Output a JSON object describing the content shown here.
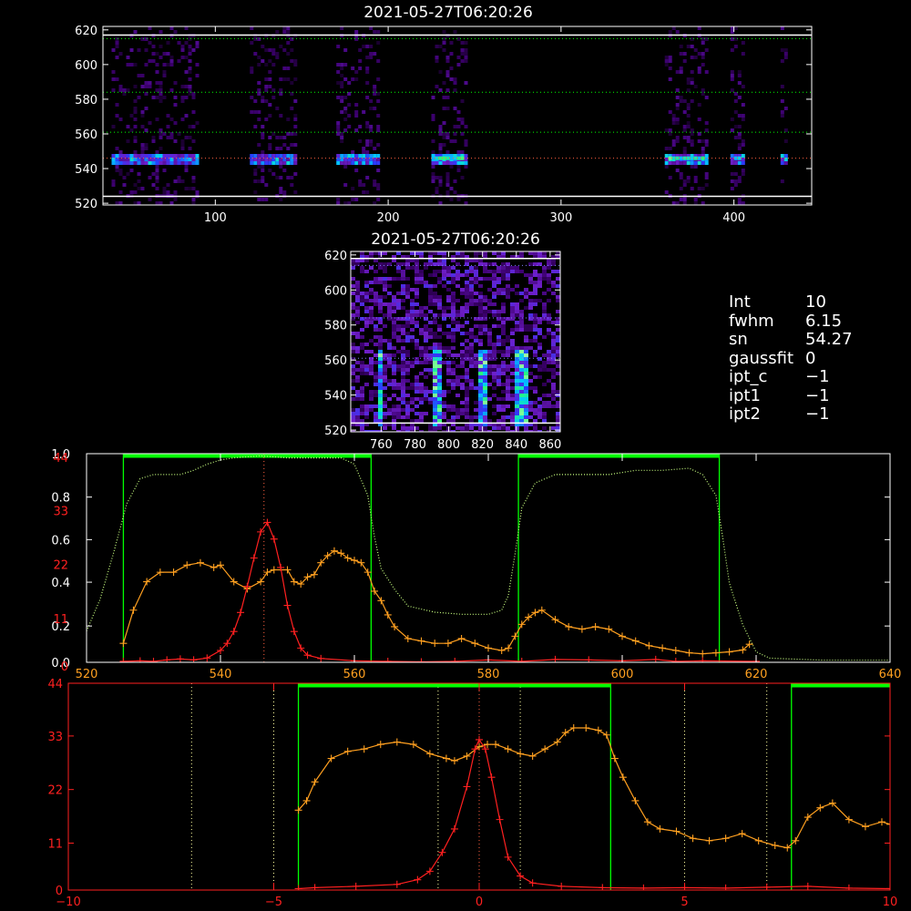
{
  "colors": {
    "background": "#000000",
    "axes": "#ffffff",
    "red_curve": "#ff2020",
    "orange_curve": "#ffa020",
    "green_window": "#00ff00",
    "dotted_curve": "#c8ff80",
    "ref_line": "#ff6040",
    "guide": "#ffffa0"
  },
  "info": [
    {
      "key": "Int",
      "value": "10"
    },
    {
      "key": "fwhm",
      "value": "6.15"
    },
    {
      "key": "sn",
      "value": "54.27"
    },
    {
      "key": "gaussfit",
      "value": "0"
    },
    {
      "key": "ipt_c",
      "value": "−1"
    },
    {
      "key": "ipt1",
      "value": "−1"
    },
    {
      "key": "ipt2",
      "value": "−1"
    }
  ],
  "chart_data": [
    {
      "id": "top_image",
      "type": "heatmap",
      "title": "2021-05-27T06:20:26",
      "xlim": [
        35,
        445
      ],
      "ylim": [
        519,
        622
      ],
      "xticks": [
        100,
        200,
        300,
        400
      ],
      "yticks": [
        520,
        540,
        560,
        580,
        600,
        620
      ],
      "data_columns": [
        [
          40,
          90
        ],
        [
          120,
          147
        ],
        [
          170,
          195
        ],
        [
          225,
          245
        ],
        [
          360,
          385
        ],
        [
          398,
          405
        ],
        [
          427,
          430
        ]
      ],
      "emission_row": 546,
      "white_lines": [
        524,
        617
      ],
      "dotted_green_lines": [
        561,
        584,
        615
      ],
      "dotted_red_line": 546
    },
    {
      "id": "zoom_image",
      "type": "heatmap",
      "title": "2021-05-27T06:20:26",
      "xlim": [
        742,
        866
      ],
      "ylim": [
        519,
        622
      ],
      "xticks": [
        760,
        780,
        800,
        820,
        840,
        860
      ],
      "yticks": [
        520,
        540,
        560,
        580,
        600,
        620
      ],
      "bright_columns": [
        758,
        792,
        818,
        840,
        842
      ],
      "white_lines": [
        524,
        618
      ],
      "dotted_lines": [
        561,
        584,
        614
      ]
    },
    {
      "id": "profile_wavelength",
      "type": "line",
      "xlim": [
        520,
        640
      ],
      "xticks": [
        520,
        540,
        560,
        580,
        600,
        620,
        640
      ],
      "left_ticks": [
        {
          "label": "0.0",
          "frac": 0.0
        },
        {
          "label": "0.2",
          "frac": 0.174
        },
        {
          "label": "0.4",
          "frac": 0.384
        },
        {
          "label": "0.6",
          "frac": 0.588
        },
        {
          "label": "0.8",
          "frac": 0.792
        },
        {
          "label": "1.0",
          "frac": 1.0
        }
      ],
      "red_ticks": [
        {
          "label": "0",
          "frac": 0.0
        },
        {
          "label": "11",
          "frac": 0.227
        },
        {
          "label": "22",
          "frac": 0.486
        },
        {
          "label": "33",
          "frac": 0.745
        },
        {
          "label": "44",
          "frac": 1.0
        }
      ],
      "ymax": 44,
      "green_windows": [
        [
          525.5,
          562.5
        ],
        [
          584.5,
          614.5
        ]
      ],
      "ref_line_x": 546.5,
      "series": [
        {
          "color": "orange",
          "points": [
            [
              525.5,
              4
            ],
            [
              527,
              11
            ],
            [
              529,
              17
            ],
            [
              531,
              19
            ],
            [
              533,
              19
            ],
            [
              535,
              20.5
            ],
            [
              537,
              21
            ],
            [
              539,
              20
            ],
            [
              540,
              20.5
            ],
            [
              542,
              17
            ],
            [
              544,
              15.5
            ],
            [
              546,
              17
            ],
            [
              547,
              19
            ],
            [
              548,
              19.5
            ],
            [
              550,
              19.5
            ],
            [
              551,
              17
            ],
            [
              552,
              16.5
            ],
            [
              553,
              18
            ],
            [
              554,
              18.5
            ],
            [
              555,
              21
            ],
            [
              556,
              22.5
            ],
            [
              557,
              23.5
            ],
            [
              558,
              23
            ],
            [
              559,
              22
            ],
            [
              560,
              21.5
            ],
            [
              561,
              21
            ],
            [
              562,
              19
            ],
            [
              563,
              15
            ],
            [
              564,
              13
            ],
            [
              565,
              10
            ],
            [
              566,
              7.5
            ],
            [
              568,
              5
            ],
            [
              570,
              4.5
            ],
            [
              572,
              4
            ],
            [
              574,
              4
            ],
            [
              576,
              5
            ],
            [
              578,
              4
            ],
            [
              580,
              3
            ],
            [
              582,
              2.5
            ],
            [
              583,
              3
            ],
            [
              584,
              5.5
            ],
            [
              585,
              8
            ],
            [
              586,
              9.5
            ],
            [
              587,
              10.5
            ],
            [
              588,
              11
            ],
            [
              590,
              9
            ],
            [
              592,
              7.5
            ],
            [
              594,
              7
            ],
            [
              596,
              7.5
            ],
            [
              598,
              7
            ],
            [
              600,
              5.5
            ],
            [
              602,
              4.5
            ],
            [
              604,
              3.5
            ],
            [
              606,
              3
            ],
            [
              608,
              2.5
            ],
            [
              610,
              2
            ],
            [
              612,
              1.8
            ],
            [
              614,
              2
            ],
            [
              616,
              2.2
            ],
            [
              618,
              2.6
            ],
            [
              619,
              3.8
            ]
          ]
        },
        {
          "color": "red",
          "points": [
            [
              525.5,
              0.2
            ],
            [
              528,
              0.3
            ],
            [
              530,
              0.2
            ],
            [
              532,
              0.5
            ],
            [
              534,
              0.7
            ],
            [
              536,
              0.5
            ],
            [
              538,
              0.9
            ],
            [
              540,
              2.5
            ],
            [
              541,
              4
            ],
            [
              542,
              6.5
            ],
            [
              543,
              10.5
            ],
            [
              544,
              16
            ],
            [
              545,
              22
            ],
            [
              546,
              27.5
            ],
            [
              547,
              29.5
            ],
            [
              548,
              26
            ],
            [
              549,
              20
            ],
            [
              550,
              12
            ],
            [
              551,
              6.5
            ],
            [
              552,
              3
            ],
            [
              553,
              1.5
            ],
            [
              555,
              0.8
            ],
            [
              560,
              0.3
            ],
            [
              565,
              0.2
            ],
            [
              570,
              0.1
            ],
            [
              575,
              0.2
            ],
            [
              580,
              0.5
            ],
            [
              585,
              0.2
            ],
            [
              590,
              0.6
            ],
            [
              595,
              0.5
            ],
            [
              600,
              0.3
            ],
            [
              605,
              0.6
            ],
            [
              608,
              0.2
            ],
            [
              612,
              0.3
            ],
            [
              620,
              0.2
            ]
          ]
        },
        {
          "color": "dotted",
          "points": [
            [
              520,
              0.15
            ],
            [
              522,
              0.3
            ],
            [
              524,
              0.52
            ],
            [
              526,
              0.76
            ],
            [
              528,
              0.88
            ],
            [
              530,
              0.9
            ],
            [
              532,
              0.9
            ],
            [
              534,
              0.9
            ],
            [
              536,
              0.92
            ],
            [
              538,
              0.95
            ],
            [
              540,
              0.97
            ],
            [
              542,
              0.98
            ],
            [
              546,
              0.99
            ],
            [
              550,
              0.98
            ],
            [
              554,
              0.98
            ],
            [
              558,
              0.98
            ],
            [
              560,
              0.95
            ],
            [
              562,
              0.8
            ],
            [
              563,
              0.6
            ],
            [
              564,
              0.45
            ],
            [
              566,
              0.35
            ],
            [
              568,
              0.27
            ],
            [
              572,
              0.24
            ],
            [
              576,
              0.23
            ],
            [
              580,
              0.23
            ],
            [
              582,
              0.25
            ],
            [
              583,
              0.32
            ],
            [
              584,
              0.52
            ],
            [
              585,
              0.74
            ],
            [
              587,
              0.86
            ],
            [
              590,
              0.9
            ],
            [
              594,
              0.9
            ],
            [
              598,
              0.9
            ],
            [
              602,
              0.92
            ],
            [
              606,
              0.92
            ],
            [
              610,
              0.93
            ],
            [
              612,
              0.9
            ],
            [
              614,
              0.8
            ],
            [
              615,
              0.6
            ],
            [
              616,
              0.38
            ],
            [
              618,
              0.18
            ],
            [
              620,
              0.05
            ],
            [
              622,
              0.02
            ],
            [
              630,
              0.01
            ],
            [
              640,
              0.01
            ]
          ]
        }
      ]
    },
    {
      "id": "profile_velocity",
      "type": "line",
      "xlim": [
        -10,
        10
      ],
      "xticks": [
        -10,
        -5,
        0,
        5,
        10
      ],
      "y_ticks": [
        {
          "label": "0",
          "frac": 0.0
        },
        {
          "label": "11",
          "frac": 0.227
        },
        {
          "label": "22",
          "frac": 0.486
        },
        {
          "label": "33",
          "frac": 0.745
        },
        {
          "label": "44",
          "frac": 1.0
        }
      ],
      "ymax": 44,
      "green_windows": [
        [
          -4.4,
          3.2
        ],
        [
          7.6,
          10
        ]
      ],
      "dotted_guides": [
        -7,
        -5,
        -1,
        1,
        5,
        7
      ],
      "ref_line_x": 0,
      "series": [
        {
          "color": "orange",
          "points": [
            [
              -4.4,
              17
            ],
            [
              -4.2,
              19
            ],
            [
              -4,
              23
            ],
            [
              -3.6,
              28
            ],
            [
              -3.2,
              29.5
            ],
            [
              -2.8,
              30
            ],
            [
              -2.4,
              31
            ],
            [
              -2,
              31.5
            ],
            [
              -1.6,
              31
            ],
            [
              -1.2,
              29
            ],
            [
              -0.8,
              28
            ],
            [
              -0.6,
              27.5
            ],
            [
              -0.3,
              28.5
            ],
            [
              0,
              30.5
            ],
            [
              0.2,
              31
            ],
            [
              0.4,
              31
            ],
            [
              0.7,
              30
            ],
            [
              1,
              29
            ],
            [
              1.3,
              28.5
            ],
            [
              1.6,
              30
            ],
            [
              1.9,
              31.5
            ],
            [
              2.1,
              33.5
            ],
            [
              2.3,
              34.5
            ],
            [
              2.6,
              34.5
            ],
            [
              2.9,
              34
            ],
            [
              3.1,
              33
            ],
            [
              3.3,
              28
            ],
            [
              3.5,
              24
            ],
            [
              3.8,
              19
            ],
            [
              4.1,
              14.5
            ],
            [
              4.4,
              13
            ],
            [
              4.8,
              12.5
            ],
            [
              5.2,
              11
            ],
            [
              5.6,
              10.5
            ],
            [
              6,
              11
            ],
            [
              6.4,
              12
            ],
            [
              6.8,
              10.5
            ],
            [
              7.2,
              9.5
            ],
            [
              7.5,
              9
            ],
            [
              7.7,
              10.5
            ],
            [
              8,
              15.5
            ],
            [
              8.3,
              17.5
            ],
            [
              8.6,
              18.5
            ],
            [
              9,
              15
            ],
            [
              9.4,
              13.5
            ],
            [
              9.8,
              14.5
            ],
            [
              10,
              14
            ]
          ]
        },
        {
          "color": "red",
          "points": [
            [
              -4.4,
              0.3
            ],
            [
              -4,
              0.5
            ],
            [
              -3,
              0.8
            ],
            [
              -2,
              1.2
            ],
            [
              -1.5,
              2.2
            ],
            [
              -1.2,
              4
            ],
            [
              -0.9,
              8
            ],
            [
              -0.6,
              13
            ],
            [
              -0.3,
              22
            ],
            [
              -0.1,
              30
            ],
            [
              0,
              32
            ],
            [
              0.15,
              30
            ],
            [
              0.3,
              24
            ],
            [
              0.5,
              15
            ],
            [
              0.7,
              7
            ],
            [
              1,
              3
            ],
            [
              1.3,
              1.5
            ],
            [
              2,
              0.8
            ],
            [
              3,
              0.5
            ],
            [
              4,
              0.4
            ],
            [
              5,
              0.5
            ],
            [
              6,
              0.4
            ],
            [
              7,
              0.6
            ],
            [
              8,
              0.8
            ],
            [
              9,
              0.4
            ],
            [
              10,
              0.3
            ]
          ]
        }
      ]
    }
  ]
}
